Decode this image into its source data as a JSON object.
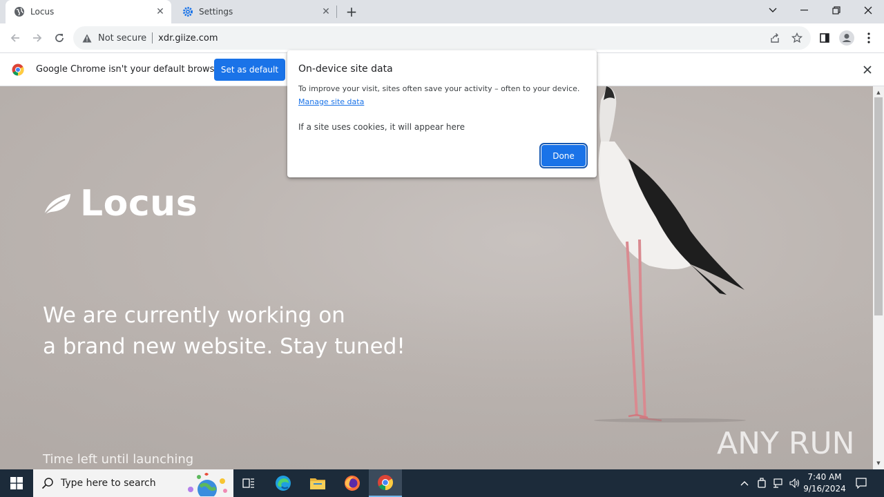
{
  "browser": {
    "tabs": [
      {
        "title": "Locus",
        "active": true,
        "icon": "globe-icon"
      },
      {
        "title": "Settings",
        "active": false,
        "icon": "gear-icon"
      }
    ],
    "address": {
      "security_label": "Not secure",
      "url": "xdr.giize.com"
    },
    "infobar": {
      "message": "Google Chrome isn't your default browser",
      "button_label": "Set as default"
    }
  },
  "popup": {
    "title": "On-device site data",
    "description": "To improve your visit, sites often save your activity – often to your device.",
    "link": "Manage site data",
    "empty_message": "If a site uses cookies, it will appear here",
    "done_label": "Done"
  },
  "page": {
    "brand": "Locus",
    "headline_line1": "We are currently working on",
    "headline_line2": "a brand new website. Stay tuned!",
    "countdown_label": "Time left until launching",
    "watermark": "ANY RUN"
  },
  "taskbar": {
    "search_placeholder": "Type here to search",
    "time": "7:40 AM",
    "date": "9/16/2024"
  },
  "colors": {
    "accent": "#1a73e8",
    "taskbar": "#1c2b3a"
  }
}
